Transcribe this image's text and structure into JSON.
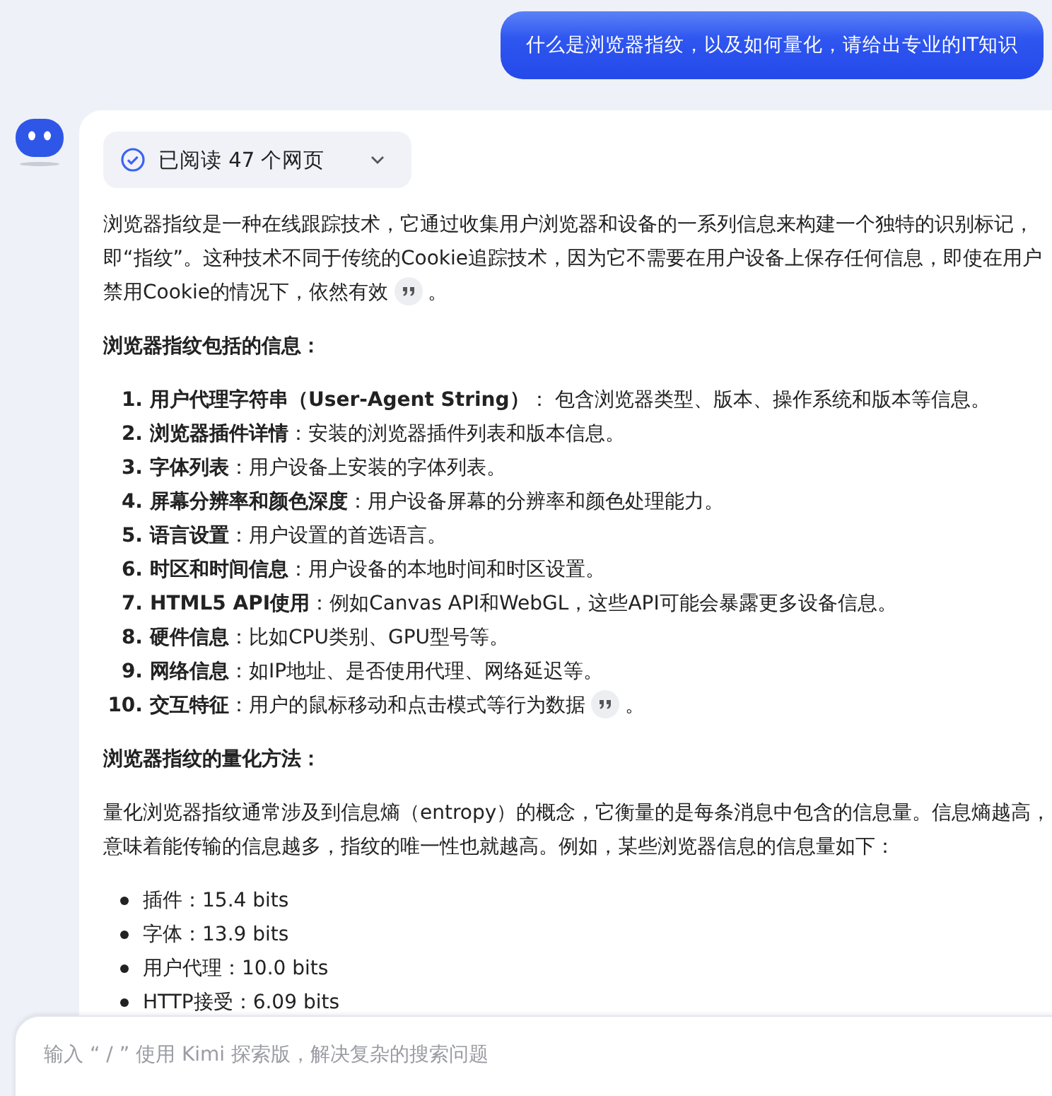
{
  "user_message": "什么是浏览器指纹，以及如何量化，请给出专业的IT知识",
  "reply": {
    "sources_badge": {
      "label": "已阅读 47 个网页",
      "expanded": false
    },
    "blocks": [
      {
        "kind": "paragraph",
        "text": "浏览器指纹是一种在线跟踪技术，它通过收集用户浏览器和设备的一系列信息来构建一个独特的识别标记，即“指纹”。这种技术不同于传统的Cookie追踪技术，因为它不需要在用户设备上保存任何信息，即使在用户禁用Cookie的情况下，依然有效",
        "citation": true,
        "tail": "。"
      },
      {
        "kind": "heading",
        "text": "浏览器指纹包括的信息："
      },
      {
        "kind": "ordered",
        "items": [
          {
            "number": "1.",
            "text": "**用户代理字符串（User-Agent String）**： 包含浏览器类型、版本、操作系统和版本等信息。",
            "citation": false
          },
          {
            "number": "2.",
            "text": "**浏览器插件详情**：安装的浏览器插件列表和版本信息。",
            "citation": false
          },
          {
            "number": "3.",
            "text": "**字体列表**：用户设备上安装的字体列表。",
            "citation": false
          },
          {
            "number": "4.",
            "text": "**屏幕分辨率和颜色深度**：用户设备屏幕的分辨率和颜色处理能力。",
            "citation": false
          },
          {
            "number": "5.",
            "text": "**语言设置**：用户设置的首选语言。",
            "citation": false
          },
          {
            "number": "6.",
            "text": "**时区和时间信息**：用户设备的本地时间和时区设置。",
            "citation": false
          },
          {
            "number": "7.",
            "text": "**HTML5 API使用**：例如Canvas API和WebGL，这些API可能会暴露更多设备信息。",
            "citation": false
          },
          {
            "number": "8.",
            "text": "**硬件信息**：比如CPU类别、GPU型号等。",
            "citation": false
          },
          {
            "number": "9.",
            "text": "**网络信息**：如IP地址、是否使用代理、网络延迟等。",
            "citation": false
          },
          {
            "number": "10.",
            "text": "**交互特征**：用户的鼠标移动和点击模式等行为数据",
            "citation": true,
            "tail": "。"
          }
        ]
      },
      {
        "kind": "heading",
        "text": "浏览器指纹的量化方法："
      },
      {
        "kind": "paragraph",
        "text": "量化浏览器指纹通常涉及到信息熵（entropy）的概念，它衡量的是每条消息中包含的信息量。信息熵越高，意味着能传输的信息越多，指纹的唯一性也就越高。例如，某些浏览器信息的信息量如下：",
        "citation": false
      },
      {
        "kind": "bullets",
        "items": [
          "插件：15.4 bits",
          "字体：13.9 bits",
          "用户代理：10.0 bits",
          "HTTP接受：6.09 bits"
        ]
      }
    ]
  },
  "input": {
    "placeholder": "输入 “ / ” 使用 Kimi 探索版，解决复杂的搜索问题"
  }
}
